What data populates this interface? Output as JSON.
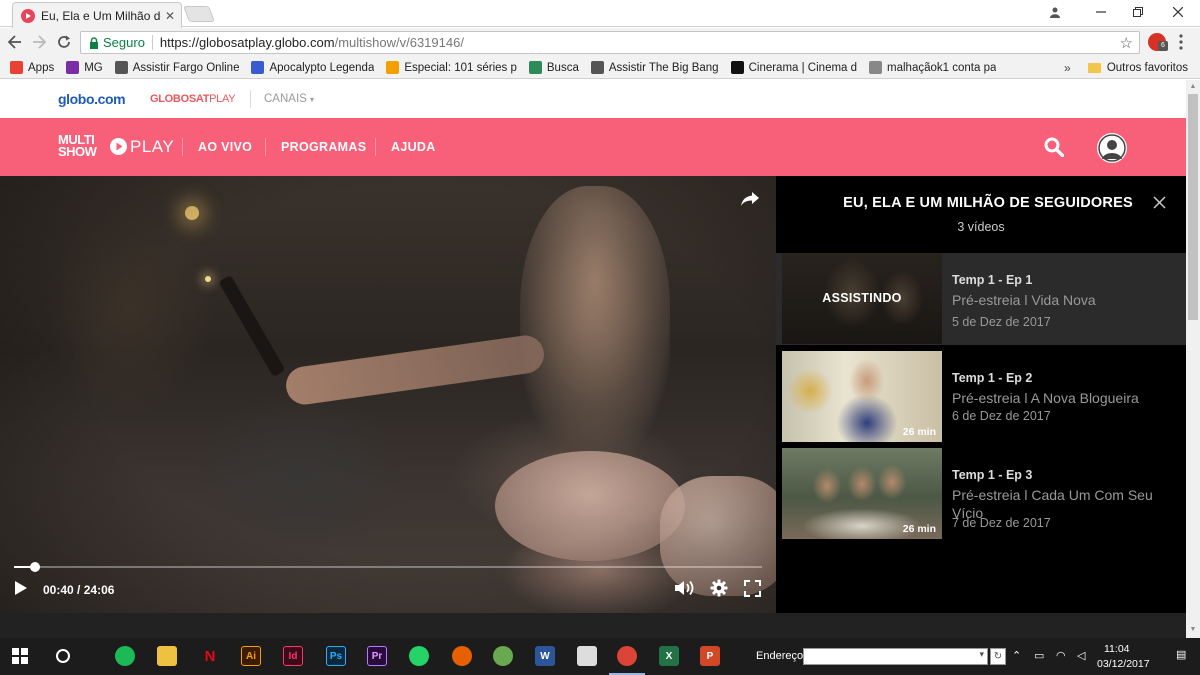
{
  "browser": {
    "tab_title": "Eu, Ela e Um Milhão de S",
    "secure_label": "Seguro",
    "url_host": "https://globosatplay.globo.com",
    "url_path": "/multishow/v/6319146/",
    "extension_badge": "6",
    "bookmarks": [
      {
        "label": "Apps",
        "icon_color": "#e94235"
      },
      {
        "label": "MG",
        "icon_color": "#7a2ea6"
      },
      {
        "label": "Assistir Fargo Online",
        "icon_color": "#555555"
      },
      {
        "label": "Apocalypto Legenda",
        "icon_color": "#3a5bd0"
      },
      {
        "label": "Especial: 101 séries p",
        "icon_color": "#f4a000"
      },
      {
        "label": "Busca",
        "icon_color": "#2e8b57"
      },
      {
        "label": "Assistir The Big Bang",
        "icon_color": "#555555"
      },
      {
        "label": "Cinerama | Cinema d",
        "icon_color": "#111111"
      },
      {
        "label": "malhaçãok1 conta pa",
        "icon_color": "#888888"
      }
    ],
    "bookmarks_overflow": "»",
    "other_bookmarks": "Outros favoritos"
  },
  "globo_bar": {
    "globo_logo": "globo.com",
    "globosat_bold": "GLOBOSAT",
    "globosat_light": "PLAY",
    "channels_label": "CANAIS"
  },
  "header": {
    "logo_line1": "MULTI",
    "logo_line2": "SHOW",
    "logo_play": "PLAY",
    "nav": [
      "AO VIVO",
      "PROGRAMAS",
      "AJUDA"
    ],
    "brand_color": "#f85f79"
  },
  "player": {
    "current_time": "00:40",
    "duration": "24:06",
    "progress_fraction": 0.028
  },
  "playlist": {
    "title": "EU, ELA E UM MILHÃO DE SEGUIDORES",
    "count": "3 vídeos",
    "episodes": [
      {
        "number": "Temp 1 - Ep 1",
        "title": "Pré-estreia l Vida Nova",
        "date": "5 de Dez de 2017",
        "status": "ASSISTINDO",
        "duration": ""
      },
      {
        "number": "Temp 1 - Ep 2",
        "title": "Pré-estreia l A Nova Blogueira",
        "date": "6 de Dez de 2017",
        "status": "",
        "duration": "26 min"
      },
      {
        "number": "Temp 1 - Ep 3",
        "title": "Pré-estreia l Cada Um Com Seu Vício",
        "date": "7 de Dez de 2017",
        "status": "",
        "duration": "26 min"
      }
    ]
  },
  "taskbar": {
    "address_label": "Endereço",
    "time": "11:04",
    "date": "03/12/2017",
    "apps": [
      {
        "name": "spotify",
        "glyph": "",
        "color": "#1db954"
      },
      {
        "name": "file-explorer",
        "glyph": "",
        "color": "#f0c040"
      },
      {
        "name": "netflix",
        "glyph": "N",
        "color": "#1c1c1c"
      },
      {
        "name": "illustrator",
        "glyph": "Ai",
        "color": "#3a1d00"
      },
      {
        "name": "indesign",
        "glyph": "Id",
        "color": "#3b0b1c"
      },
      {
        "name": "photoshop",
        "glyph": "Ps",
        "color": "#0a2a3c"
      },
      {
        "name": "premiere",
        "glyph": "Pr",
        "color": "#2a0a3c"
      },
      {
        "name": "whatsapp",
        "glyph": "",
        "color": "#25d366"
      },
      {
        "name": "firefox",
        "glyph": "",
        "color": "#e66000"
      },
      {
        "name": "app-green",
        "glyph": "",
        "color": "#6aa84f"
      },
      {
        "name": "word",
        "glyph": "W",
        "color": "#2b579a"
      },
      {
        "name": "store",
        "glyph": "",
        "color": "#dddddd"
      },
      {
        "name": "chrome",
        "glyph": "",
        "color": "#db4437"
      },
      {
        "name": "excel",
        "glyph": "X",
        "color": "#217346"
      },
      {
        "name": "powerpoint",
        "glyph": "P",
        "color": "#d24726"
      }
    ]
  }
}
